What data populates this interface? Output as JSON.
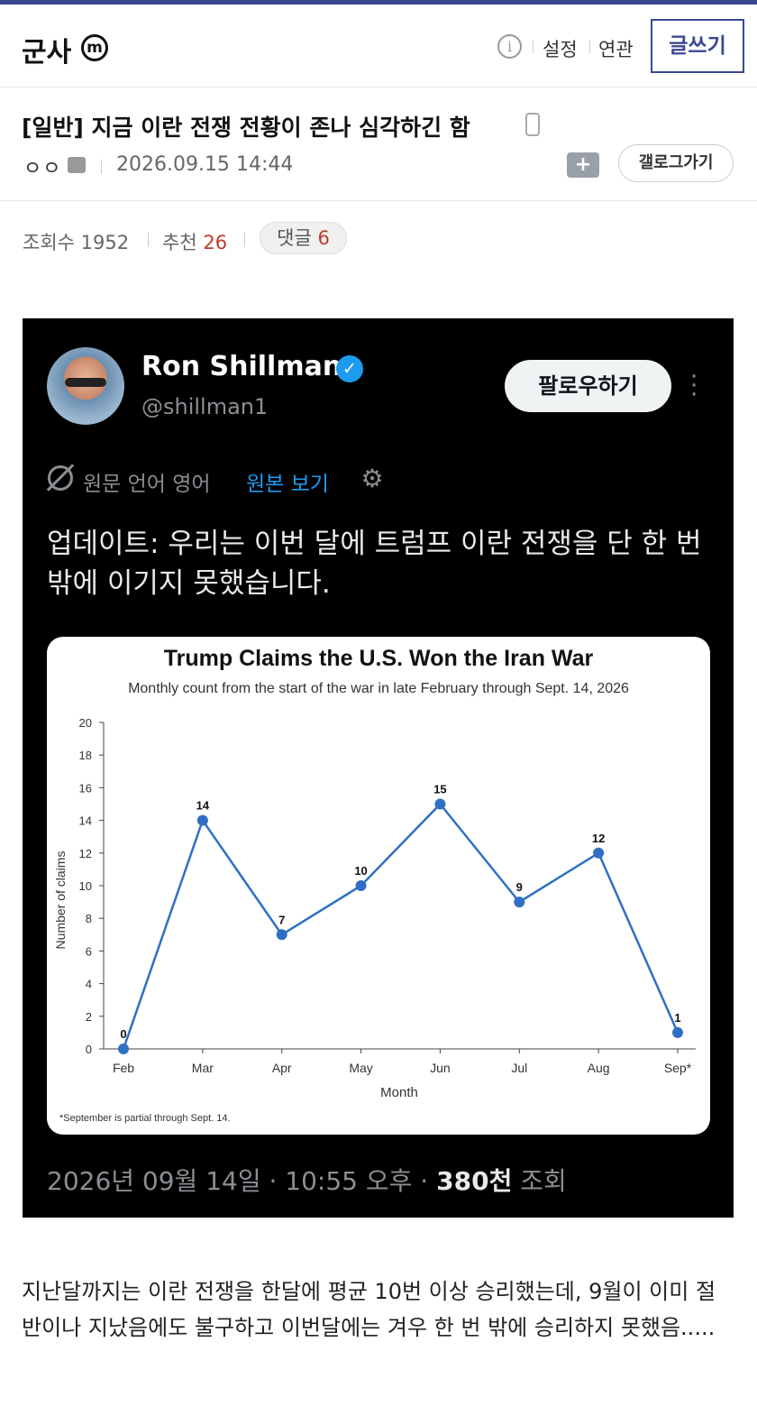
{
  "header": {
    "gallery_name": "군사",
    "gallery_badge": "m",
    "info_icon": "ⓘ",
    "settings_label": "설정",
    "related_label": "연관",
    "write_label": "글쓰기"
  },
  "post": {
    "title": "[일반] 지금 이란 전쟁 전황이 존나 심각하긴 함",
    "author": "ㅇㅇ",
    "date": "2026.09.15 14:44",
    "gallog_label": "갤로그가기",
    "views_label": "조회수",
    "views": "1952",
    "recommend_label": "추천",
    "recommend": "26",
    "comments_label": "댓글",
    "comments": "6"
  },
  "tweet": {
    "name": "Ron Shillman",
    "handle": "@shillman1",
    "follow_label": "팔로우하기",
    "original_language": "원문 언어 영어",
    "view_original": "원본 보기",
    "text": "업데이트: 우리는 이번 달에 트럼프 이란 전쟁을 단 한 번밖에 이기지 못했습니다.",
    "footer_date": "2026년 09월 14일 · 10:55 오후 · ",
    "footer_views": "380천",
    "footer_views_label": " 조회"
  },
  "chart_data": {
    "type": "line",
    "title": "Trump Claims the U.S. Won the Iran War",
    "subtitle": "Monthly count from the start of the war in late February through Sept. 14, 2026",
    "xlabel": "Month",
    "ylabel": "Number of claims",
    "categories": [
      "Feb",
      "Mar",
      "Apr",
      "May",
      "Jun",
      "Jul",
      "Aug",
      "Sep*"
    ],
    "values": [
      0,
      14,
      7,
      10,
      15,
      9,
      12,
      1
    ],
    "ylim": [
      0,
      20
    ],
    "yticks": [
      0,
      2,
      4,
      6,
      8,
      10,
      12,
      14,
      16,
      18,
      20
    ],
    "grid": false,
    "color": "#2f6fc4",
    "footnote": "*September is partial through Sept. 14."
  },
  "body_text": "지난달까지는 이란 전쟁을 한달에 평균 10번 이상 승리했는데, 9월이 이미 절반이나 지났음에도 불구하고 이번달에는 겨우 한 번 밖에 승리하지 못했음....."
}
